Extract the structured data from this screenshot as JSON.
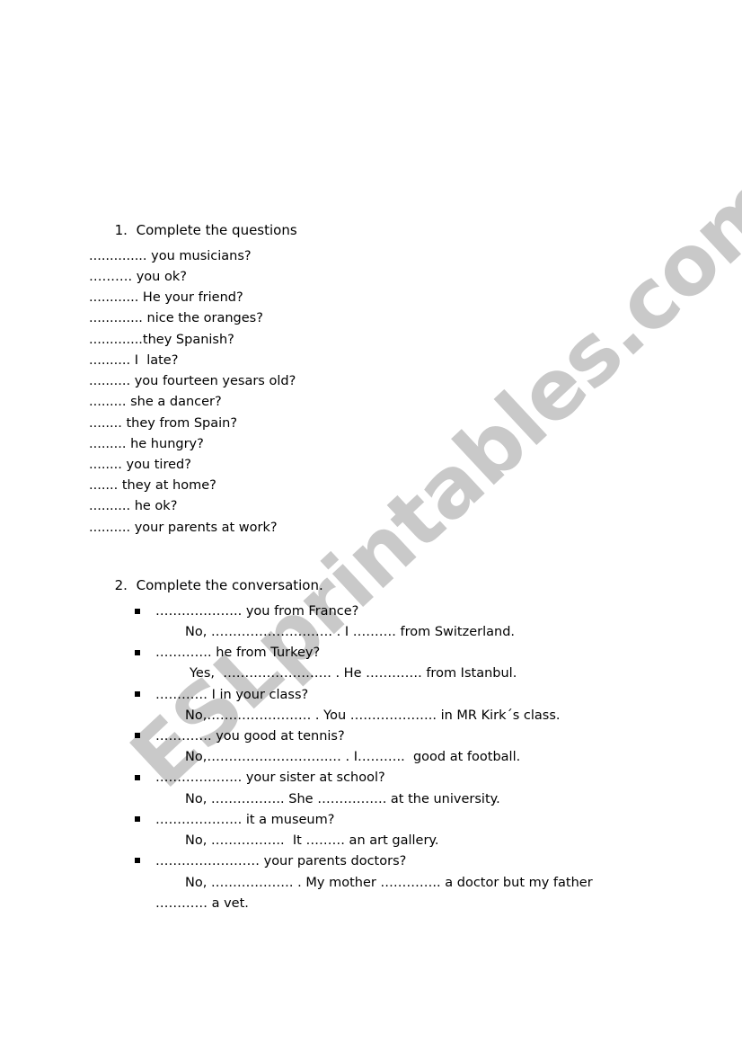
{
  "watermark": "ESLprintables.com",
  "colors": {
    "text": "#000000",
    "watermark": "#c9c9c9",
    "background": "#ffffff"
  },
  "section1": {
    "number": "1.",
    "title": "Complete the questions",
    "questions": [
      ".............. you musicians?",
      "………. you ok?",
      "............ He your friend?",
      "............. nice the oranges?",
      ".............they Spanish?",
      ".......... I  late?",
      ".......... you fourteen yesars old?",
      "......... she a dancer?",
      "........ they from Spain?",
      "......... he hungry?",
      "........ you tired?",
      "....... they at home?",
      ".......... he ok?",
      ".......... your parents at work?"
    ]
  },
  "section2": {
    "number": "2.",
    "title": "Complete the conversation.",
    "items": [
      {
        "question": "……………….. you from France?",
        "answer": "No, ………………………. . I ………. from Switzerland."
      },
      {
        "question": "…………. he from Turkey?",
        "answer": "Yes,  ……………………. . He …………. from Istanbul."
      },
      {
        "question": "………… I in your class?",
        "answer": "No,…………………… . You ……………….. in MR Kirk´s class."
      },
      {
        "question": "…………. you good at tennis?",
        "answer": "No,……………………….… . I………..  good at football."
      },
      {
        "question": "……………….. your sister at school?",
        "answer": "No, …………….. She ……………. at the university."
      },
      {
        "question": "……………….. it a museum?",
        "answer": "No, ……………..  It ……… an art gallery."
      },
      {
        "question": "…………………… your parents doctors?",
        "answer": "No, ………………. . My mother ………….. a doctor but my father",
        "continuation": "………… a vet."
      }
    ]
  }
}
